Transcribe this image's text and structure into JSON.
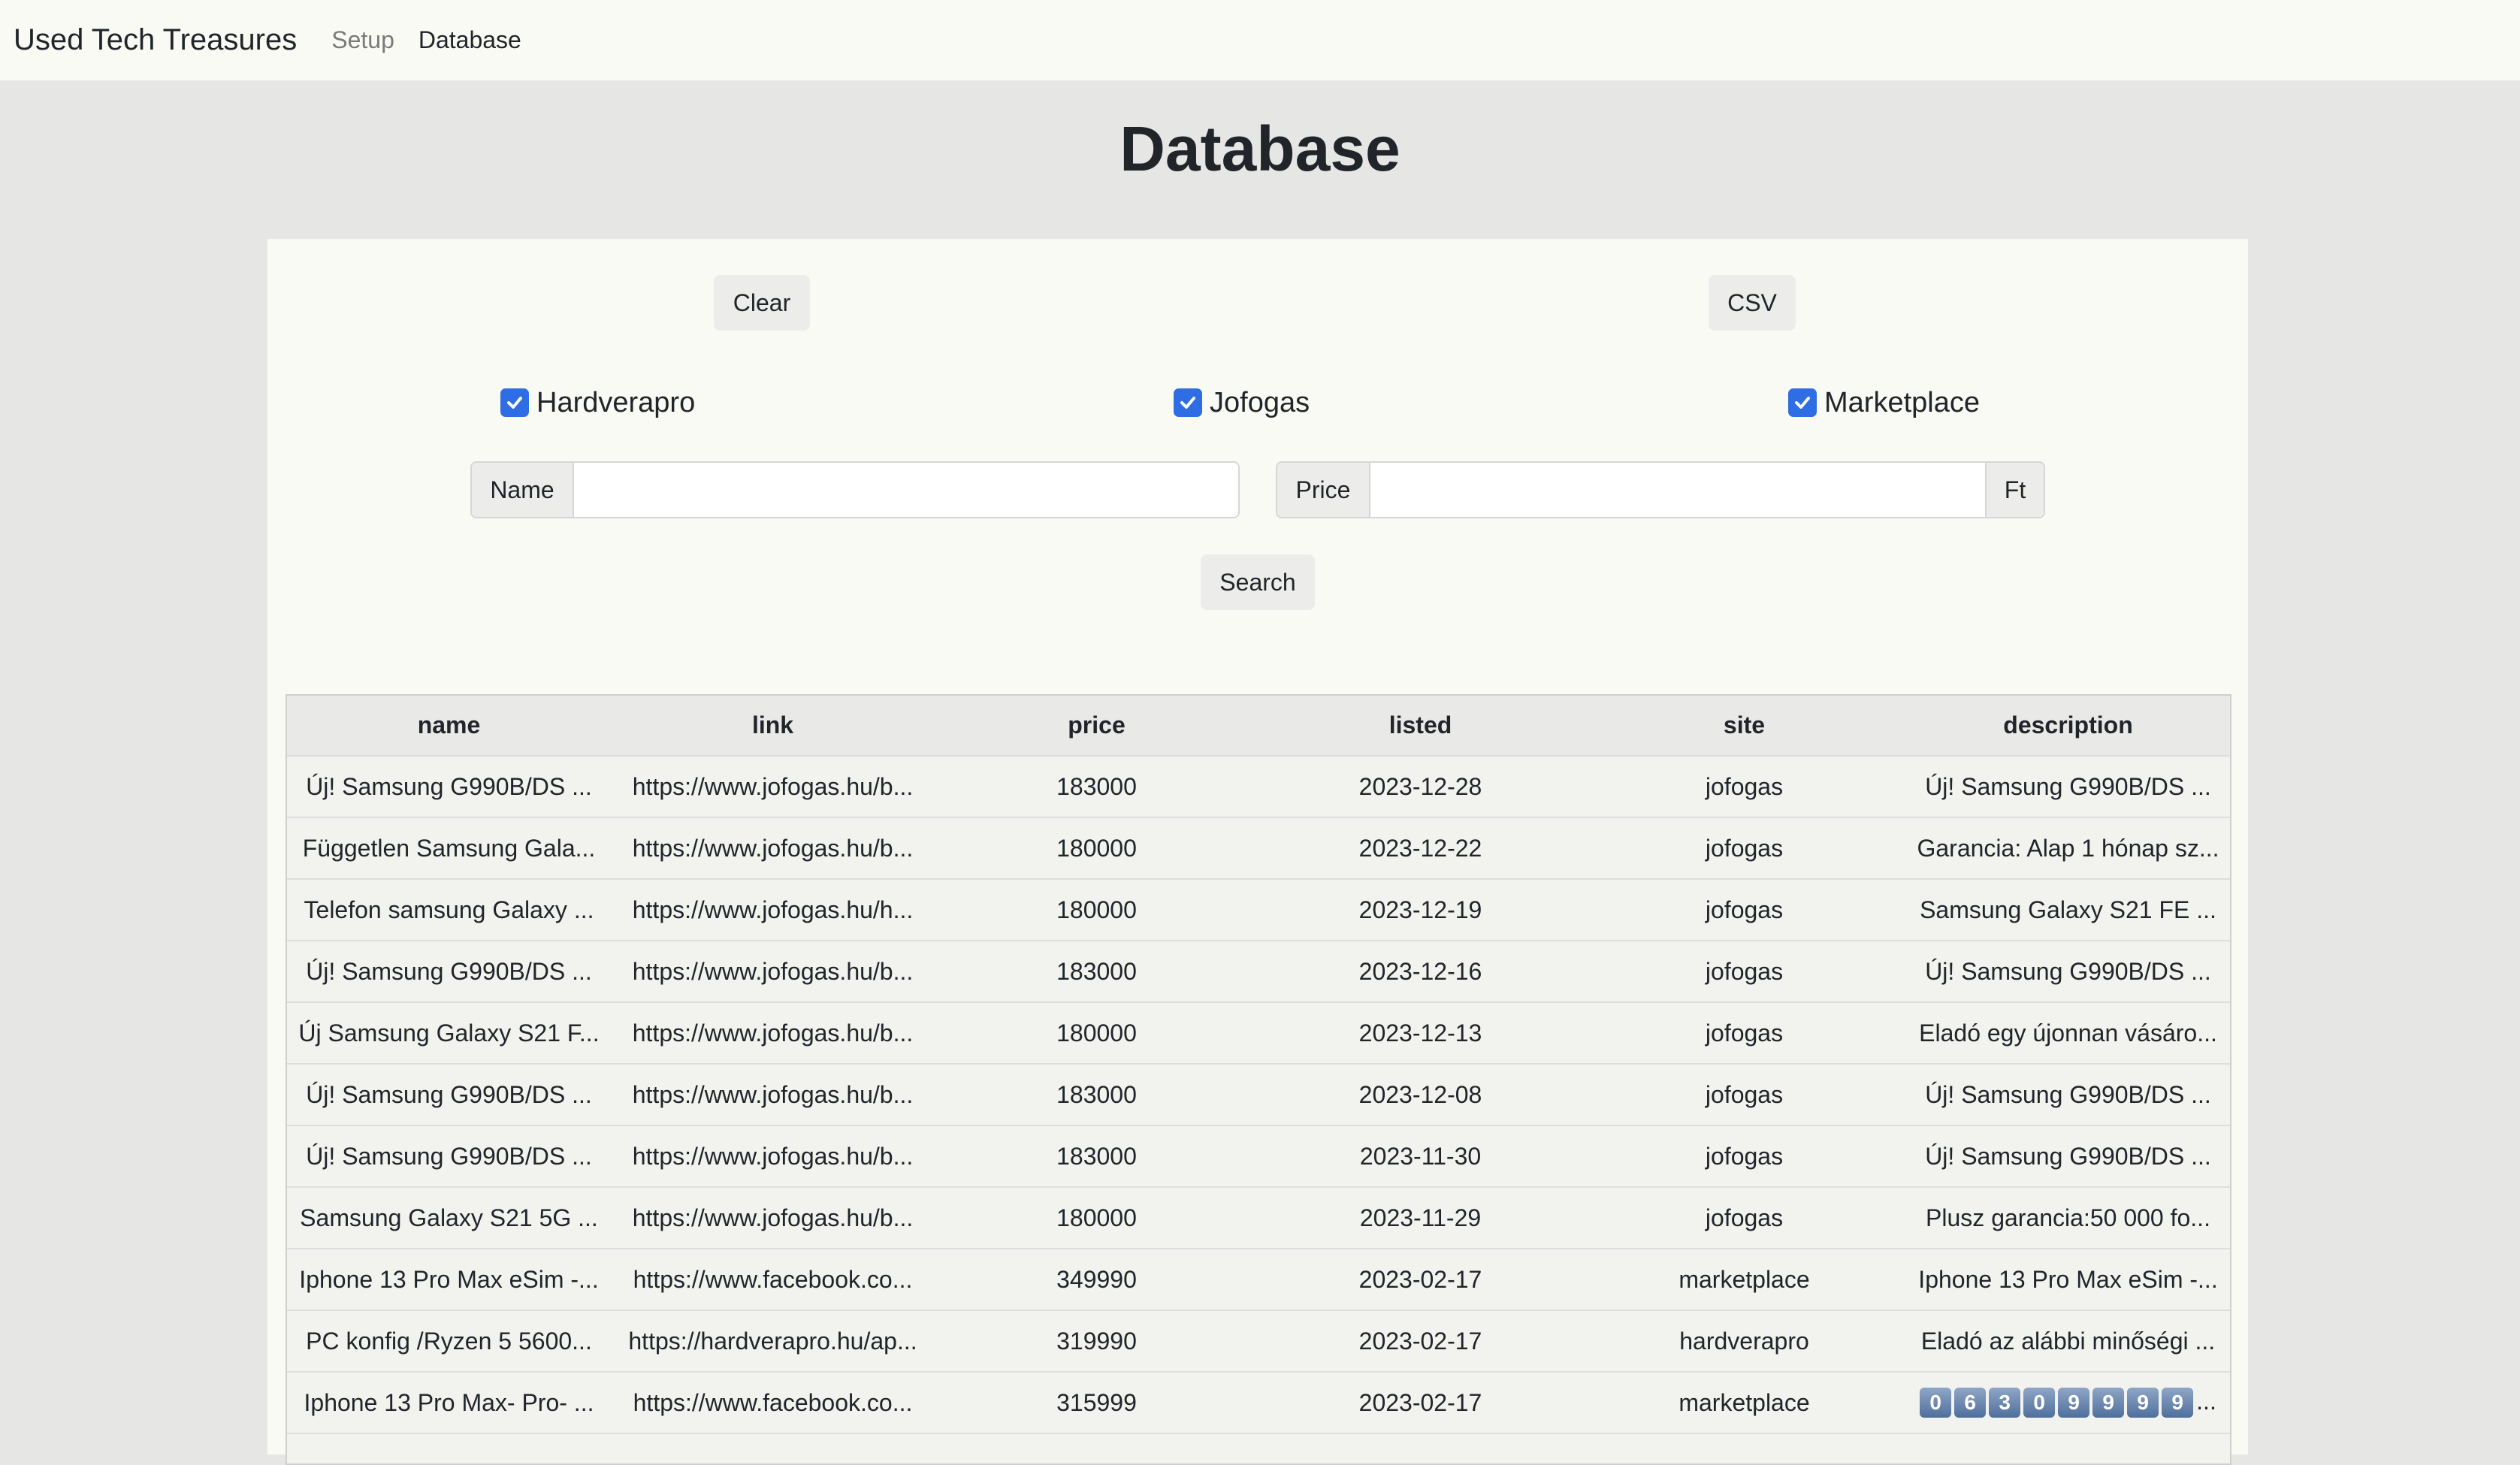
{
  "navbar": {
    "brand": "Used Tech Treasures",
    "links": [
      {
        "label": "Setup",
        "active": false
      },
      {
        "label": "Database",
        "active": true
      }
    ]
  },
  "page": {
    "title": "Database"
  },
  "controls": {
    "clear_label": "Clear",
    "csv_label": "CSV",
    "search_label": "Search",
    "sites": [
      {
        "label": "Hardverapro",
        "checked": true
      },
      {
        "label": "Jofogas",
        "checked": true
      },
      {
        "label": "Marketplace",
        "checked": true
      }
    ],
    "name_field": {
      "label": "Name",
      "value": ""
    },
    "price_field": {
      "label": "Price",
      "value": "",
      "unit": "Ft"
    }
  },
  "colors": {
    "checkbox": "#2e6de3",
    "panel": "#fafaf5",
    "background": "#e6e6e5"
  },
  "table": {
    "headers": [
      "name",
      "link",
      "price",
      "listed",
      "site",
      "description"
    ],
    "rows": [
      [
        "Új! Samsung G990B/DS ...",
        "https://www.jofogas.hu/b...",
        "183000",
        "2023-12-28",
        "jofogas",
        "Új! Samsung G990B/DS ..."
      ],
      [
        "Független Samsung Gala...",
        "https://www.jofogas.hu/b...",
        "180000",
        "2023-12-22",
        "jofogas",
        "Garancia: Alap 1 hónap sz..."
      ],
      [
        "Telefon samsung Galaxy ...",
        "https://www.jofogas.hu/h...",
        "180000",
        "2023-12-19",
        "jofogas",
        "Samsung Galaxy S21 FE ..."
      ],
      [
        "Új! Samsung G990B/DS ...",
        "https://www.jofogas.hu/b...",
        "183000",
        "2023-12-16",
        "jofogas",
        "Új! Samsung G990B/DS ..."
      ],
      [
        "Új Samsung Galaxy S21 F...",
        "https://www.jofogas.hu/b...",
        "180000",
        "2023-12-13",
        "jofogas",
        "Eladó egy újonnan vásáro..."
      ],
      [
        "Új! Samsung G990B/DS ...",
        "https://www.jofogas.hu/b...",
        "183000",
        "2023-12-08",
        "jofogas",
        "Új! Samsung G990B/DS ..."
      ],
      [
        "Új! Samsung G990B/DS ...",
        "https://www.jofogas.hu/b...",
        "183000",
        "2023-11-30",
        "jofogas",
        "Új! Samsung G990B/DS ..."
      ],
      [
        "Samsung Galaxy S21 5G ...",
        "https://www.jofogas.hu/b...",
        "180000",
        "2023-11-29",
        "jofogas",
        "Plusz garancia:50 000 fo..."
      ],
      [
        "Iphone 13 Pro Max eSim -...",
        "https://www.facebook.co...",
        "349990",
        "2023-02-17",
        "marketplace",
        "Iphone 13 Pro Max eSim -..."
      ],
      [
        "PC konfig /Ryzen 5 5600...",
        "https://hardverapro.hu/ap...",
        "319990",
        "2023-02-17",
        "hardverapro",
        "Eladó az alábbi minőségi ..."
      ],
      [
        "Iphone 13 Pro Max- Pro- ...",
        "https://www.facebook.co...",
        "315999",
        "2023-02-17",
        "marketplace",
        ""
      ]
    ],
    "last_row_description_digits": [
      "0",
      "6",
      "3",
      "0",
      "9",
      "9",
      "9",
      "9"
    ],
    "last_row_description_suffix": "..."
  }
}
